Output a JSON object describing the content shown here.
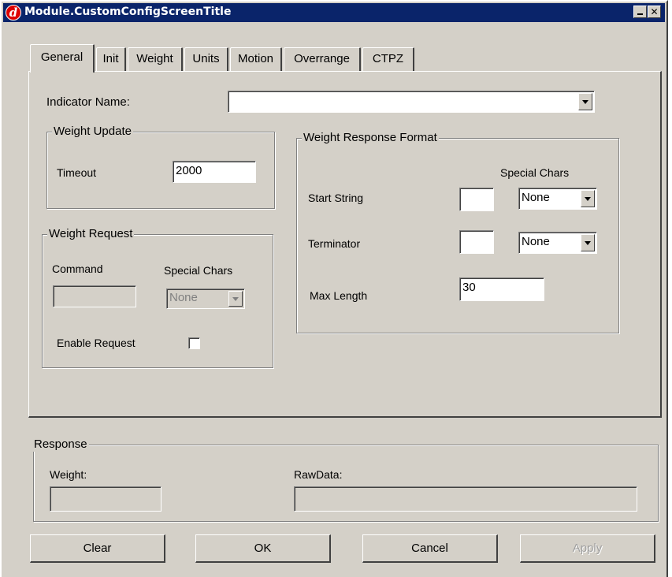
{
  "window": {
    "title": "Module.CustomConfigScreenTitle",
    "app_icon_glyph": "d"
  },
  "tabs": [
    {
      "label": "General",
      "active": true
    },
    {
      "label": "Init",
      "active": false
    },
    {
      "label": "Weight",
      "active": false
    },
    {
      "label": "Units",
      "active": false
    },
    {
      "label": "Motion",
      "active": false
    },
    {
      "label": "Overrange",
      "active": false
    },
    {
      "label": "CTPZ",
      "active": false
    }
  ],
  "general": {
    "indicator_name_label": "Indicator Name:",
    "indicator_name_value": "",
    "weight_update": {
      "title": "Weight Update",
      "timeout_label": "Timeout",
      "timeout_value": "2000"
    },
    "weight_request": {
      "title": "Weight Request",
      "command_label": "Command",
      "special_chars_label": "Special Chars",
      "command_value": "",
      "special_chars_value": "None",
      "enable_request_label": "Enable Request",
      "enable_request_checked": false
    },
    "weight_response_format": {
      "title": "Weight Response Format",
      "special_chars_label": "Special Chars",
      "start_string_label": "Start String",
      "start_string_value": "",
      "start_special_value": "None",
      "terminator_label": "Terminator",
      "terminator_value": "",
      "terminator_special_value": "None",
      "max_length_label": "Max Length",
      "max_length_value": "30"
    }
  },
  "response": {
    "title": "Response",
    "weight_label": "Weight:",
    "weight_value": "",
    "rawdata_label": "RawData:",
    "rawdata_value": ""
  },
  "buttons": {
    "clear": "Clear",
    "ok": "OK",
    "cancel": "Cancel",
    "apply": "Apply"
  },
  "colors": {
    "face": "#d4d0c8",
    "titlebar": "#0a246a",
    "app_icon": "#dd0000"
  }
}
